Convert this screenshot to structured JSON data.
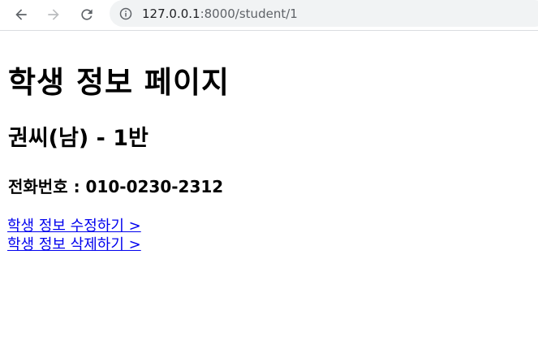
{
  "browser": {
    "url_host": "127.0.0.1",
    "url_path": ":8000/student/1",
    "icons": {
      "back": "back-arrow-icon",
      "forward": "forward-arrow-icon",
      "reload": "reload-icon",
      "info": "info-icon"
    }
  },
  "page": {
    "title": "학생 정보 페이지",
    "student_heading": "권씨(남) - 1반",
    "phone_line": "전화번호 : 010-0230-2312",
    "links": {
      "edit": "학생 정보 수정하기 >",
      "delete": "학생 정보 삭제하기 >"
    }
  },
  "colors": {
    "link": "#0000ee",
    "text": "#000000",
    "omnibox_bg": "#f1f3f4"
  }
}
